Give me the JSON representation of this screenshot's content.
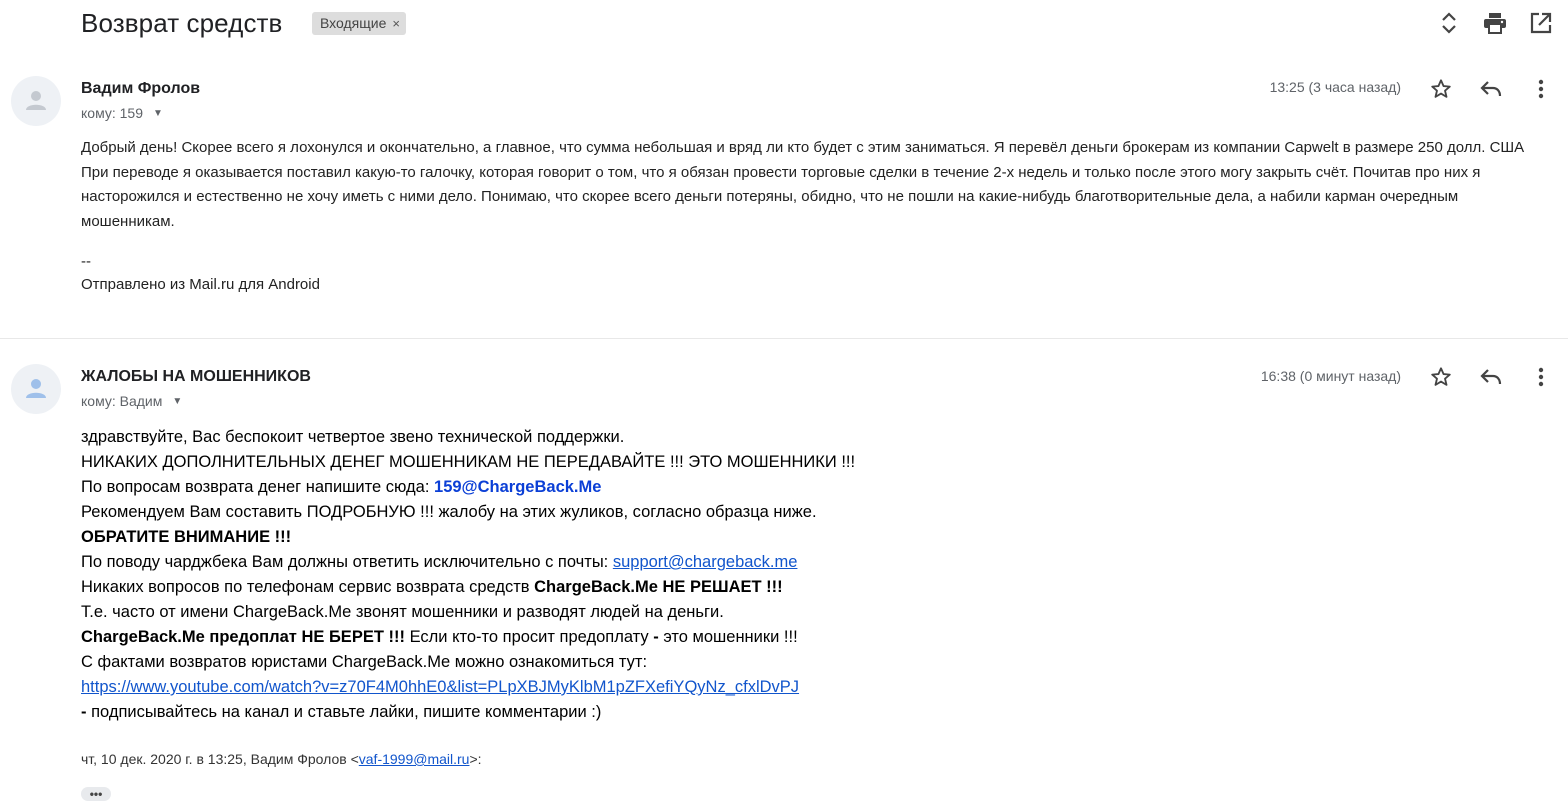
{
  "subject": "Возврат средств",
  "label": {
    "name": "Входящие",
    "remove": "×"
  },
  "top_actions": [
    "expand-collapse-icon",
    "print-icon",
    "open-new-window-icon"
  ],
  "messages": [
    {
      "sender": "Вадим Фролов",
      "recipient": "кому: 159",
      "time": "13:25 (3 часа назад)",
      "body": "Добрый день! Скорее всего я лохонулся и окончательно, а главное, что сумма небольшая и вряд ли кто будет с этим заниматься. Я перевёл деньги брокерам из компании Capwelt в размере 250 долл. США При переводе я оказывается поставил какую-то галочку, которая говорит о том, что я обязан провести торговые сделки в течение 2-х недель и только после этого могу закрыть счёт. Почитав про них я насторожился и естественно не хочу иметь с ними дело. Понимаю, что скорее всего деньги потеряны, обидно, что не пошли на какие-нибудь благотворительные дела, а набили карман очередным мошенникам.",
      "sig_sep": "--",
      "sig": "Отправлено из Mail.ru для Android"
    },
    {
      "sender": "ЖАЛОБЫ НА МОШЕННИКОВ",
      "recipient": "кому: Вадим",
      "time": "16:38 (0 минут назад)",
      "lines": {
        "l1": "здравствуйте, Вас беспокоит четвертое звено технической поддержки.",
        "l2": "НИКАКИХ ДОПОЛНИТЕЛЬНЫХ ДЕНЕГ МОШЕННИКАМ НЕ ПЕРЕДАВАЙТЕ !!! ЭТО МОШЕННИКИ !!!",
        "l3_prefix": "По вопросам возврата денег напишите сюда: ",
        "l3_email": "159@ChargeBack.Me",
        "l4": "Рекомендуем Вам составить ПОДРОБНУЮ !!! жалобу на этих жуликов, согласно образца ниже.",
        "l5": "ОБРАТИТЕ ВНИМАНИЕ !!!",
        "l6_prefix": "По поводу чарджбека Вам должны ответить исключительно с почты: ",
        "l6_email": "support@chargeback.me",
        "l7_prefix": "Никаких вопросов по телефонам сервис возврата средств ",
        "l7_bold": "ChargeBack.Me НЕ РЕШАЕТ !!!",
        "l8": "Т.е. часто от имени ChargeBack.Me звонят мошенники и разводят людей на деньги.",
        "l9_bold": "ChargeBack.Me предоплат НЕ БЕРЕТ !!!",
        "l9_mid": " Если кто-то просит предоплату ",
        "l9_dash": "-",
        "l9_end": " это мошенники !!!",
        "l10": "С фактами возвратов юристами ChargeBack.Me можно ознакомиться тут:",
        "l11_link": "https://www.youtube.com/watch?v=z70F4M0hhE0&list=PLpXBJMyKlbM1pZFXefiYQyNz_cfxlDvPJ",
        "l12_dash": " -",
        "l12_rest": " подписывайтесь на канал и ставьте лайки, пишите комментарии :)"
      },
      "quote_prefix": "чт, 10 дек. 2020 г. в 13:25, Вадим Фролов <",
      "quote_email": "vaf-1999@mail.ru",
      "quote_suffix": ">:",
      "show_trimmed": "•••"
    }
  ],
  "colors": {
    "link": "#1155cc",
    "email_bold": "#0b3fd6",
    "chip_bg": "#dddddd",
    "muted": "#5f6368"
  }
}
